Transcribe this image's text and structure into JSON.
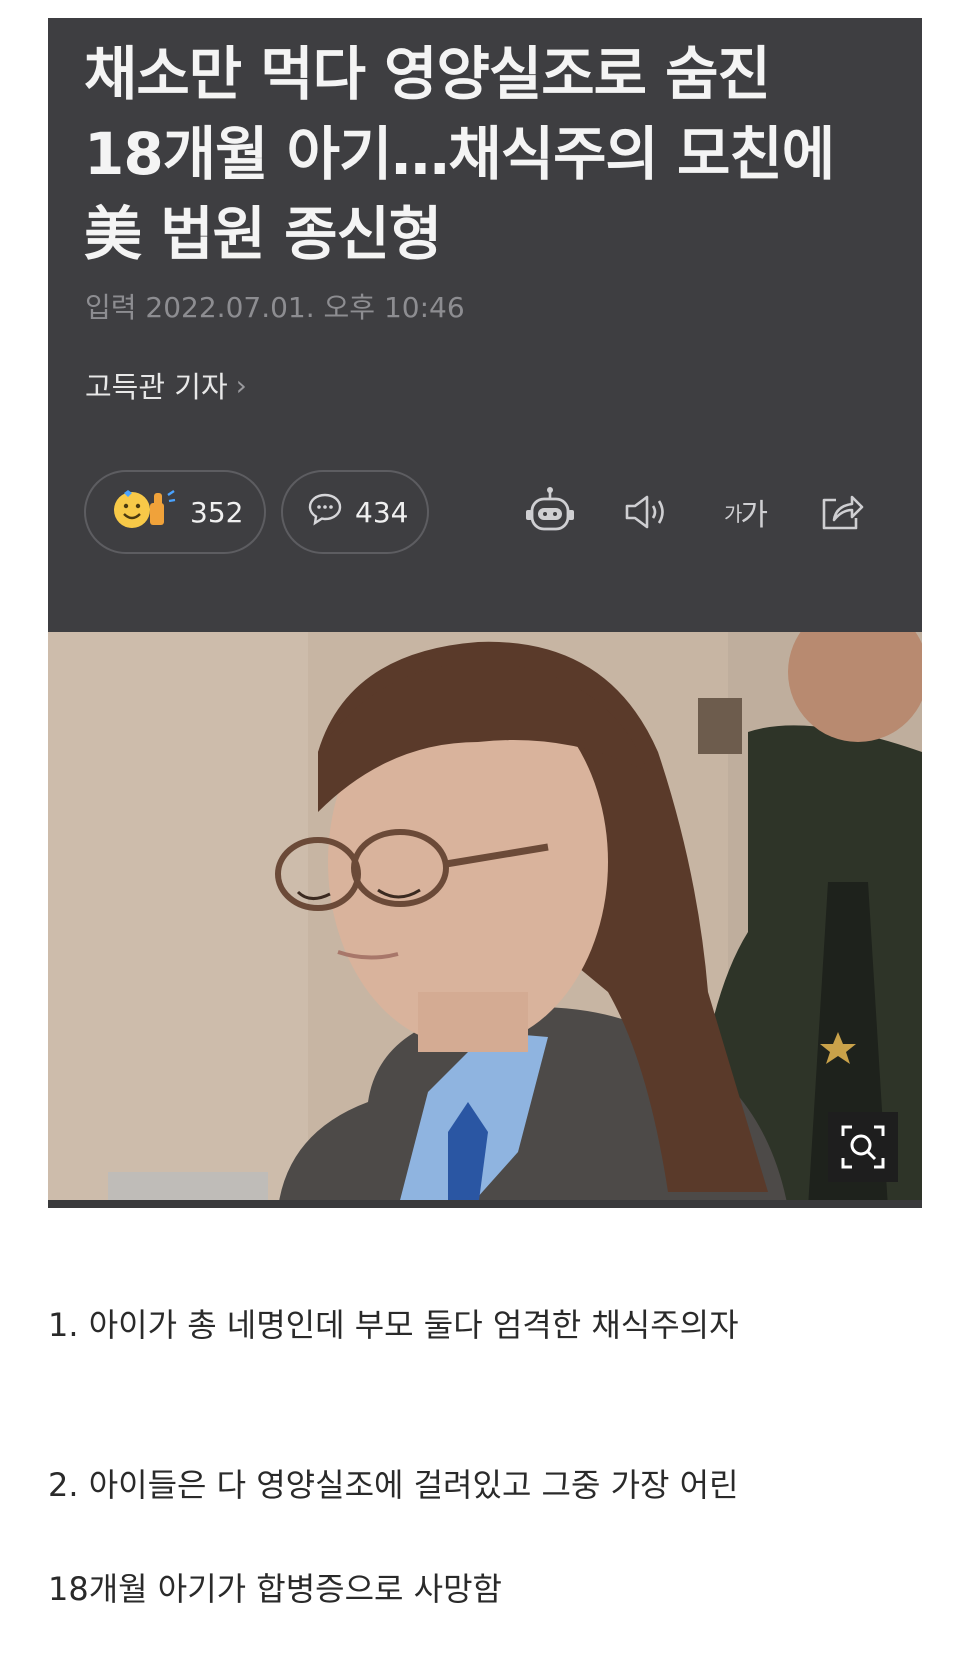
{
  "article": {
    "title_lines": [
      "채소만 먹다 영양실조로 숨진",
      "18개월 아기…채식주의 모친에",
      "美 법원 종신형"
    ],
    "dateline": "입력 2022.07.01. 오후 10:46",
    "author": "고득관 기자",
    "reactions_count": "352",
    "comments_count": "434",
    "font_size_label_small": "가",
    "font_size_label_large": "가"
  },
  "icons": {
    "reaction": "smile-thumbs-icon",
    "comment": "speech-bubble-icon",
    "ai_summary": "robot-icon",
    "read_aloud": "speaker-icon",
    "share": "share-icon",
    "zoom": "magnify-icon",
    "author_more": "chevron-right-icon"
  },
  "post": {
    "line1": "1. 아이가 총 네명인데 부모 둘다 엄격한 채식주의자",
    "line2": "2. 아이들은 다 영양실조에 걸려있고 그중 가장 어린",
    "line3": "18개월 아기가 합병증으로 사망함"
  },
  "colors": {
    "header_bg": "#3e3e41",
    "page_bg": "#ffffff"
  }
}
